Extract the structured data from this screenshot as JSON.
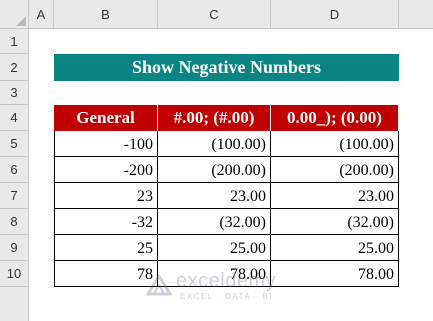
{
  "columns": [
    "A",
    "B",
    "C",
    "D"
  ],
  "rows": [
    "1",
    "2",
    "3",
    "4",
    "5",
    "6",
    "7",
    "8",
    "9",
    "10"
  ],
  "title": "Show Negative Numbers",
  "table": {
    "headers": [
      "General",
      "#.00; (#.00)",
      "0.00_); (0.00)"
    ],
    "rows": [
      [
        "-100",
        "(100.00)",
        "(100.00)"
      ],
      [
        "-200",
        "(200.00)",
        "(200.00)"
      ],
      [
        "23",
        "23.00",
        "23.00"
      ],
      [
        "-32",
        "(32.00)",
        "(32.00)"
      ],
      [
        "25",
        "25.00",
        "25.00"
      ],
      [
        "78",
        "78.00",
        "78.00"
      ]
    ]
  },
  "watermark": {
    "name": "exceldemy",
    "tagline": "EXCEL · DATA · BI",
    "color": "#4a5a8a"
  },
  "colors": {
    "title_bg": "#0b8584",
    "header_bg": "#c00000",
    "grid_header_bg": "#e9e9e9"
  }
}
